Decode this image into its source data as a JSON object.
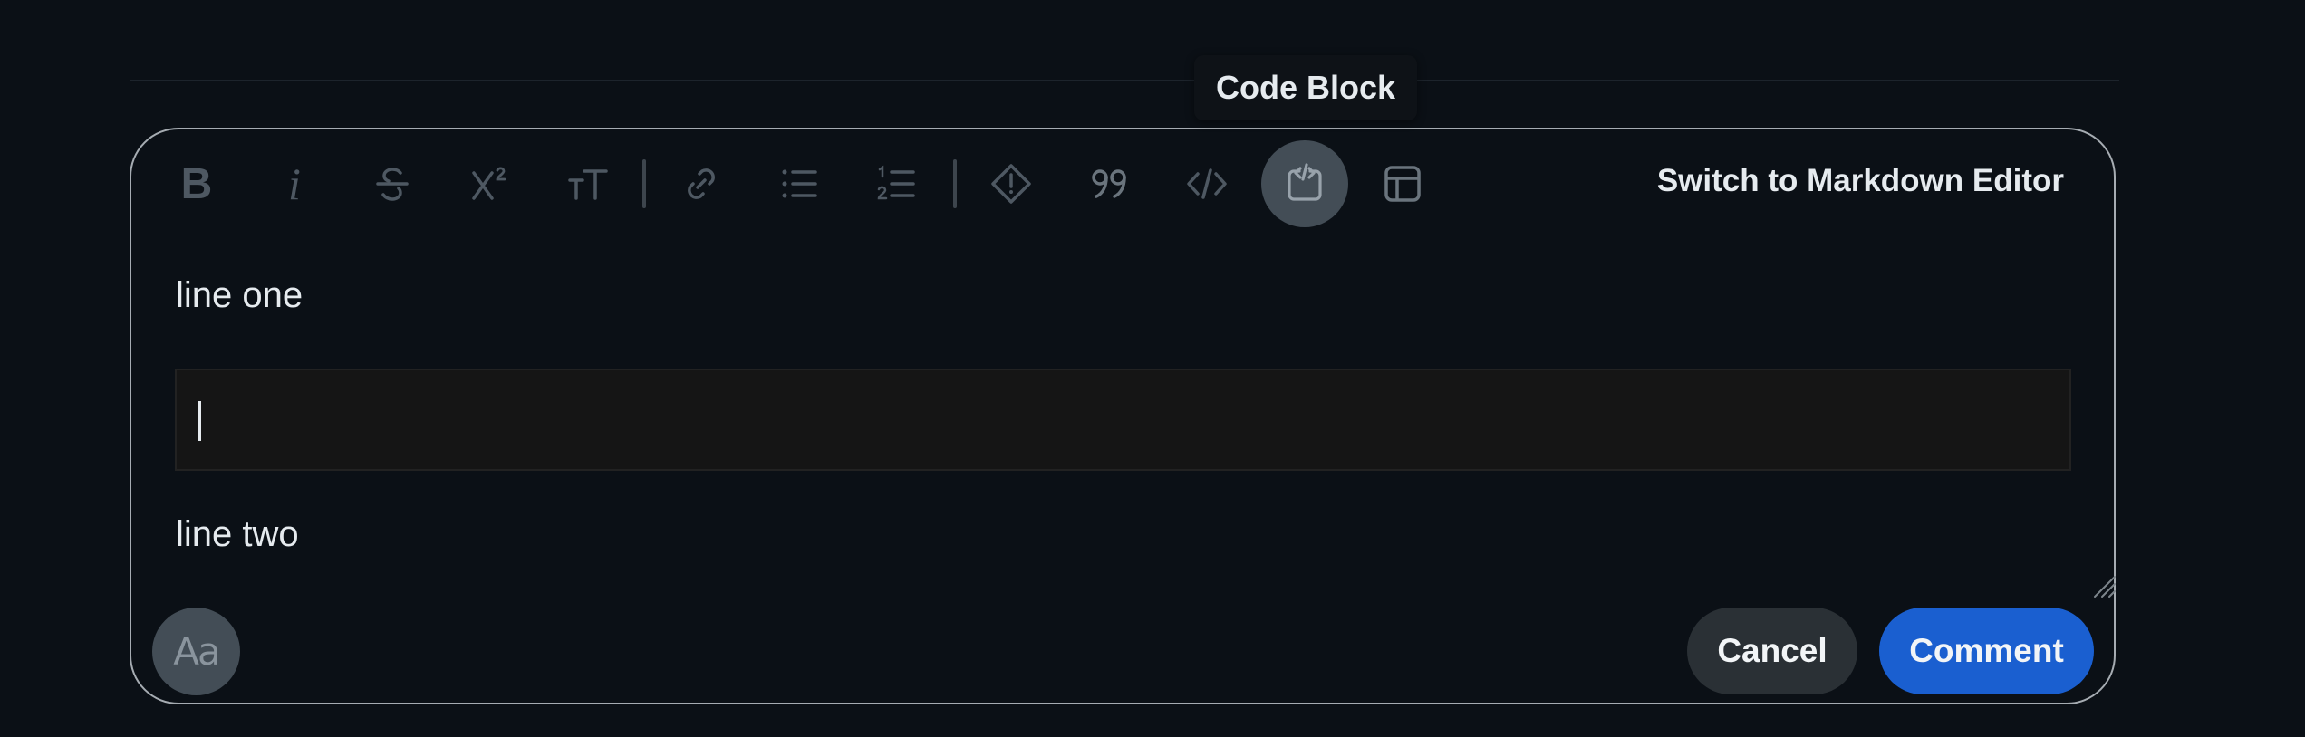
{
  "tooltip": {
    "text": "Code Block"
  },
  "toolbar": {
    "buttons": [
      {
        "name": "bold",
        "icon": "bold-icon"
      },
      {
        "name": "italic",
        "icon": "italic-icon"
      },
      {
        "name": "strikethrough",
        "icon": "strikethrough-icon"
      },
      {
        "name": "superscript",
        "icon": "superscript-icon"
      },
      {
        "name": "text-size",
        "icon": "text-size-icon"
      },
      {
        "name": "link",
        "icon": "link-icon"
      },
      {
        "name": "bulleted-list",
        "icon": "bulleted-list-icon"
      },
      {
        "name": "numbered-list",
        "icon": "numbered-list-icon"
      },
      {
        "name": "spoiler",
        "icon": "spoiler-icon"
      },
      {
        "name": "quote",
        "icon": "quote-icon"
      },
      {
        "name": "inline-code",
        "icon": "inline-code-icon"
      },
      {
        "name": "code-block",
        "icon": "code-block-icon",
        "active": true
      },
      {
        "name": "table",
        "icon": "table-icon"
      }
    ],
    "switch_label": "Switch to Markdown Editor"
  },
  "content": {
    "line_one": "line one",
    "line_two": "line two"
  },
  "footer": {
    "formatting_icon": "Aa",
    "cancel_label": "Cancel",
    "comment_label": "Comment"
  },
  "colors": {
    "background": "#0b1016",
    "comment_button": "#1a5fd0",
    "cancel_button": "#2a3035",
    "active_tool": "#434d56"
  }
}
